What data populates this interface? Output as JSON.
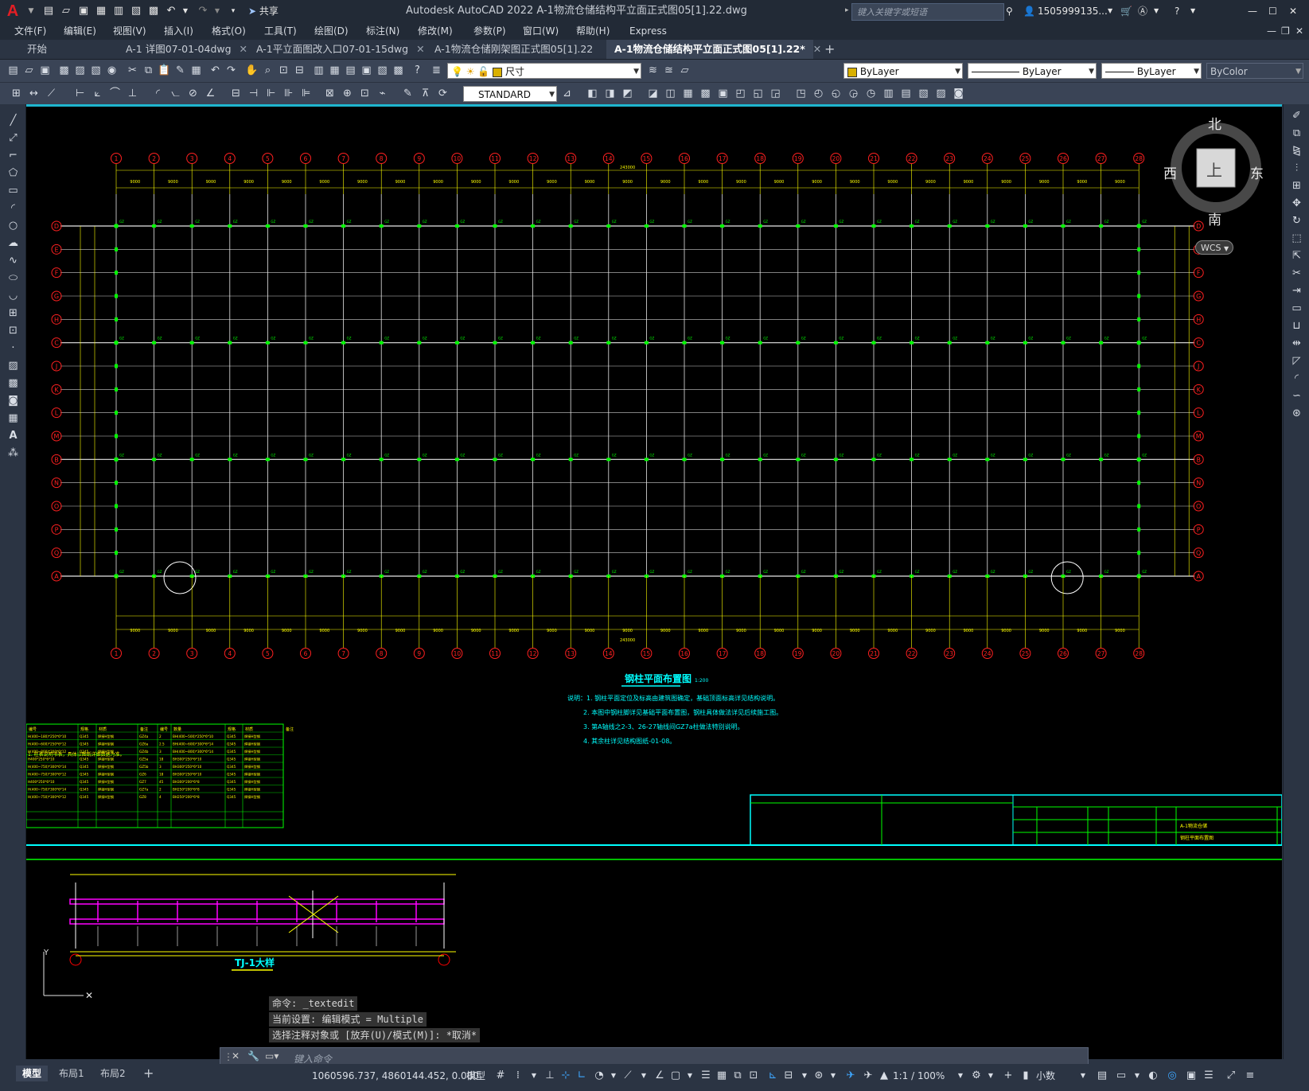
{
  "app": {
    "title": "Autodesk AutoCAD 2022    A-1物流仓储结构平立面正式图05[1].22.dwg",
    "logo": "A",
    "share_label": "共享",
    "search_placeholder": "键入关键字或短语",
    "user": "1505999135...",
    "accent": "#1fb6cf"
  },
  "menu": [
    "文件(F)",
    "编辑(E)",
    "视图(V)",
    "插入(I)",
    "格式(O)",
    "工具(T)",
    "绘图(D)",
    "标注(N)",
    "修改(M)",
    "参数(P)",
    "窗口(W)",
    "帮助(H)",
    "Express"
  ],
  "tabs": [
    {
      "label": "开始"
    },
    {
      "label": "A-1 详图07-01-04dwg"
    },
    {
      "label": "A-1平立面图改入口07-01-15dwg"
    },
    {
      "label": "A-1物流仓储刚架图正式图05[1].22"
    },
    {
      "label": "A-1物流仓储结构平立面正式图05[1].22*"
    }
  ],
  "toolbar": {
    "layer": "尺寸",
    "color": "ByLayer",
    "linetype": "ByLayer",
    "lineweight": "ByLayer",
    "plotstyle": "ByColor",
    "textstyle": "STANDARD"
  },
  "viewcube": {
    "north": "北",
    "south": "南",
    "east": "东",
    "west": "西",
    "top": "上",
    "wcs": "WCS"
  },
  "drawing": {
    "column_axes": [
      "1",
      "2",
      "3",
      "4",
      "5",
      "6",
      "7",
      "8",
      "9",
      "10",
      "11",
      "12",
      "13",
      "14",
      "15",
      "16",
      "17",
      "18",
      "19",
      "20",
      "21",
      "22",
      "23",
      "24",
      "25",
      "26",
      "27",
      "28"
    ],
    "row_axes": [
      "D",
      "E",
      "F",
      "G",
      "H",
      "C",
      "J",
      "K",
      "L",
      "M",
      "B",
      "N",
      "O",
      "P",
      "Q",
      "A"
    ],
    "bay_dim": "9000",
    "total_dim": "243000",
    "plan_title": "钢柱平面布置图",
    "plan_scale": "1:200",
    "notes": [
      "说明：1. 钢柱平面定位及标高由建筑图确定，基础顶面标高详见结构说明。",
      "2. 本图中钢柱脚详见基础平面布置图，钢柱具体做法详见后续施工图。",
      "3. 第A轴线之2-3、26-27轴线间GZ7a柱做法特别说明。",
      "4. 其余柱详见结构图纸-01-08。"
    ],
    "table_title": "1. 柱表说明书表，具体以图纸详细数据为准。",
    "table_headers": [
      "编号",
      "规格",
      "材质",
      "备注",
      "编号",
      "数量",
      "规格",
      "材质",
      "备注"
    ],
    "table_rows": [
      [
        "H(400~180)*250*6*10",
        "Q345",
        "焊接H型钢",
        "GZ4a",
        "2",
        "BH(400~500)*250*6*10",
        "Q345",
        "焊接H型钢"
      ],
      [
        "H(400~600)*250*6*12",
        "Q345",
        "焊接H型钢",
        "GZ6a",
        "2.5",
        "BH(400~600)*300*6*14",
        "Q345",
        "焊接H型钢"
      ],
      [
        "H(400~800)*300*6*12",
        "Q345",
        "焊接H型钢",
        "GZ4b",
        "3",
        "BH(400~800)*300*6*14",
        "Q345",
        "焊接H型钢"
      ],
      [
        "H400*250*6*10",
        "Q345",
        "焊接H型钢",
        "GZ5a",
        "18",
        "BH300*250*6*10",
        "Q345",
        "焊接H型钢"
      ],
      [
        "H(400~750)*300*6*14",
        "Q345",
        "焊接H型钢",
        "GZ5b",
        "3",
        "BH300*250*6*10",
        "Q345",
        "焊接H型钢"
      ],
      [
        "H(400~750)*300*6*12",
        "Q345",
        "焊接H型钢",
        "GZ6",
        "18",
        "BH300*250*6*10",
        "Q345",
        "焊接H型钢"
      ],
      [
        "H400*250*6*10",
        "Q345",
        "焊接H型钢",
        "GZ7",
        "45",
        "BH300*200*6*8",
        "Q345",
        "焊接H型钢"
      ],
      [
        "H(400~750)*300*6*14",
        "Q345",
        "焊接H型钢",
        "GZ7a",
        "2",
        "BH250*200*6*8",
        "Q345",
        "焊接H型钢"
      ],
      [
        "H(400~750)*300*6*12",
        "Q345",
        "焊接H型钢",
        "GZ8",
        "4",
        "BH250*200*6*8",
        "Q345",
        "焊接H型钢"
      ]
    ],
    "titleblock_project": "A-1物流仓储",
    "titleblock_sheet": "钢柱平面布置图",
    "section_title": "TJ-1大样"
  },
  "command": {
    "history": [
      "命令:  _textedit",
      "当前设置: 编辑模式 = Multiple",
      "选择注释对象或 [放弃(U)/模式(M)]: *取消*"
    ],
    "placeholder": "键入命令"
  },
  "layouts": [
    "模型",
    "布局1",
    "布局2"
  ],
  "status": {
    "coords": "1060596.737, 4860144.452, 0.000",
    "space": "模型",
    "scale": "1:1 / 100%",
    "units": "小数"
  }
}
